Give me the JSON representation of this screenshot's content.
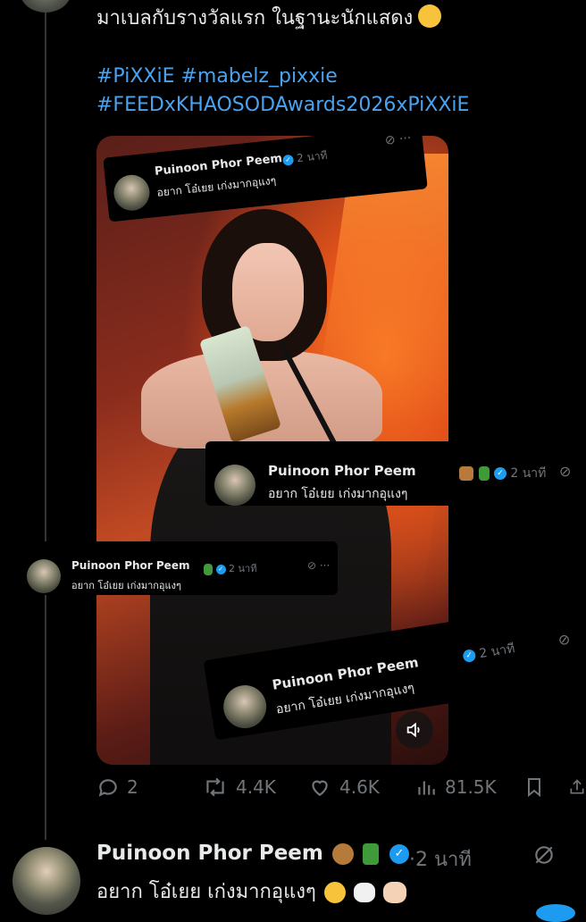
{
  "post": {
    "text": "มาเบลกับรางวัลแรก ในฐานะนักแสดง",
    "hashtags": [
      "#PiXXiE #mabelz_pixxie",
      "#FEEDxKHAOSODAwards2026xPiXXiE"
    ]
  },
  "overlay_card": {
    "name": "Puinoon Phor Peem",
    "time": "2 นาที",
    "text": "อยาก โอ๋เยย เก่งมากอุแงๆ"
  },
  "actions": {
    "replies": "2",
    "reposts": "4.4K",
    "likes": "4.6K",
    "views": "81.5K"
  },
  "reply": {
    "name": "Puinoon Phor Peem",
    "time": "2 นาที",
    "text": "อยาก โอ๋เยย เก่งมากอุแงๆ"
  },
  "icons": [
    "comment-icon",
    "repost-icon",
    "like-icon",
    "views-icon",
    "bookmark-icon",
    "share-icon",
    "mute-icon",
    "grok-icon",
    "verified-icon"
  ],
  "colors": {
    "accent": "#1d9bf0",
    "hashtag": "#4aa3f0",
    "muted": "#71767b",
    "background": "#000000"
  }
}
